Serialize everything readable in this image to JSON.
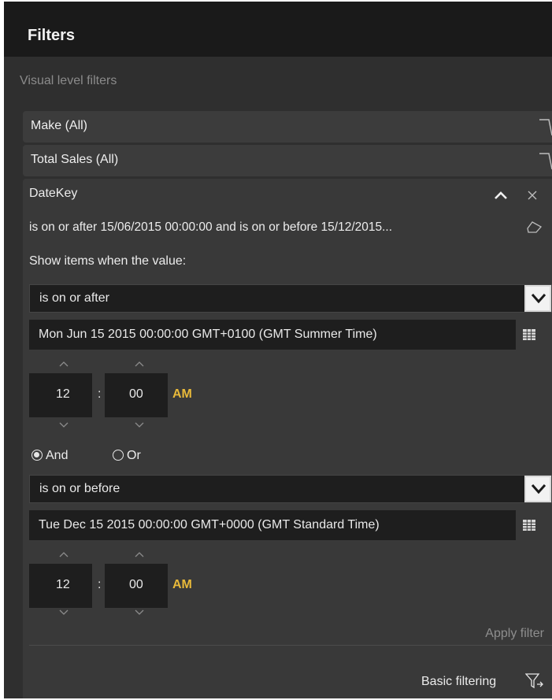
{
  "header": {
    "title": "Filters"
  },
  "section": {
    "label": "Visual level filters"
  },
  "filters": {
    "make": "Make (All)",
    "total_sales": "Total Sales (All)"
  },
  "datekey": {
    "name": "DateKey",
    "summary": "is on or after 15/06/2015 00:00:00 and is on or before 15/12/2015...",
    "show_items_label": "Show items when the value:",
    "condition1": {
      "operator": "is on or after",
      "date": "Mon Jun 15 2015 00:00:00 GMT+0100 (GMT Summer Time)",
      "hour": "12",
      "minute": "00",
      "ampm": "AM"
    },
    "logic": {
      "and_label": "And",
      "or_label": "Or",
      "selected": "And"
    },
    "condition2": {
      "operator": "is on or before",
      "date": "Tue Dec 15 2015 00:00:00 GMT+0000 (GMT Standard Time)",
      "hour": "12",
      "minute": "00",
      "ampm": "AM"
    },
    "apply_label": "Apply filter",
    "basic_filtering_label": "Basic filtering"
  },
  "colors": {
    "panel_bg": "#2f2f2f",
    "header_bg": "#1a1a1a",
    "ampm_accent": "#e8b93a"
  },
  "icons": [
    "chevron-up-icon",
    "close-icon",
    "eraser-icon",
    "chevron-down-icon",
    "calendar-icon",
    "filter-icon"
  ]
}
